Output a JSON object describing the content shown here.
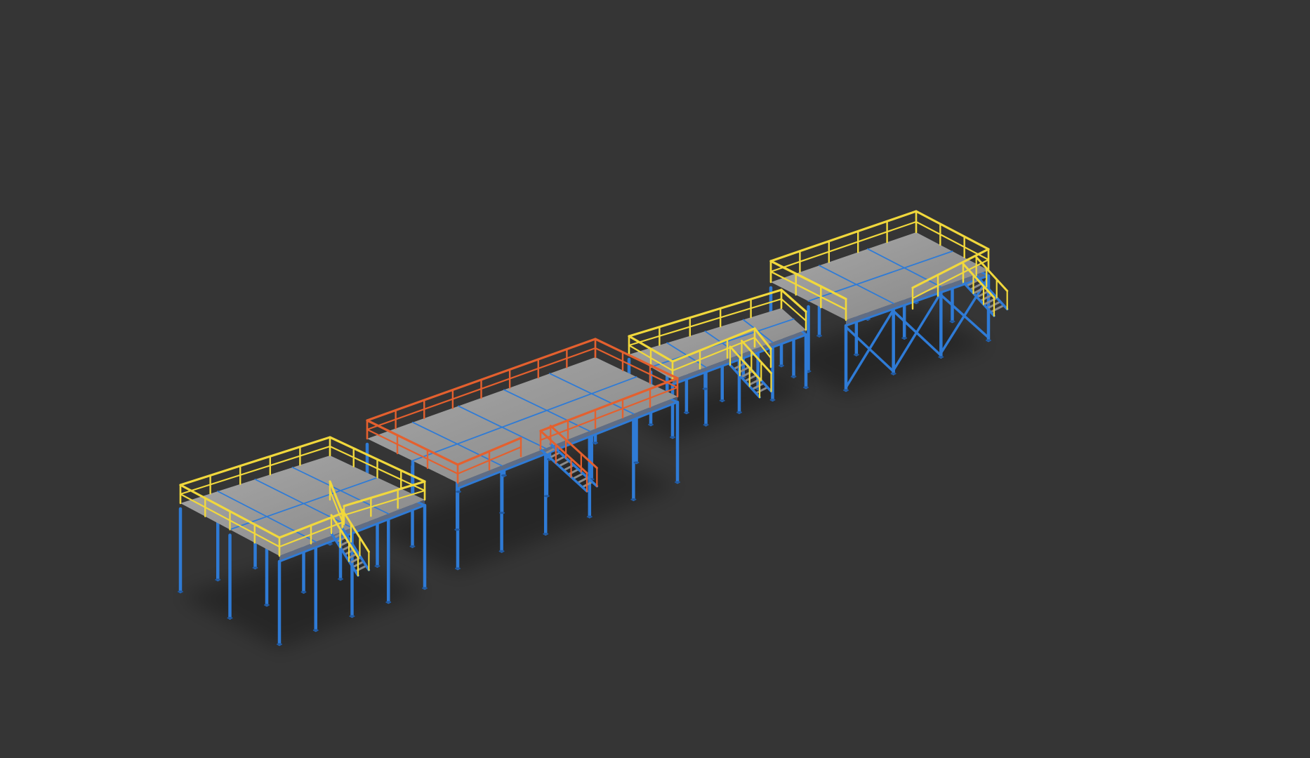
{
  "scene": {
    "background_color": "#353535",
    "colors": {
      "deck_light": "#a9a9a9",
      "deck_dark": "#858585",
      "deck_edge": "#5f6d86",
      "deck_seams": "#2f7bd6",
      "columns": "#2f7bd6",
      "column_shade": "#205aa3",
      "railing_yellow": "#f1d83c",
      "railing_orange": "#e4602e",
      "stair_tread": "#8b8b8b"
    },
    "platforms": [
      {
        "id": "platform-1",
        "railing": "yellow",
        "has_stair": true,
        "has_bracing": false
      },
      {
        "id": "platform-2",
        "railing": "orange",
        "has_stair": true,
        "has_bracing": false
      },
      {
        "id": "platform-3",
        "railing": "yellow",
        "has_stair": true,
        "has_bracing": false
      },
      {
        "id": "platform-4",
        "railing": "yellow",
        "has_stair": true,
        "has_bracing": true
      }
    ]
  }
}
